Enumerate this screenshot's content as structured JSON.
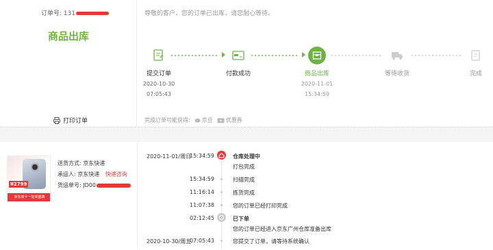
{
  "order": {
    "number_label": "订单号: 131",
    "status_title": "商品出库",
    "notice": "尊敬的客户，您的订单已出库，请您耐心等待。",
    "print_label": "打印订单"
  },
  "steps": [
    {
      "label": "提交订单",
      "date": "2020-10-30",
      "time": "07:05:43",
      "state": "done",
      "icon": "order-form-icon"
    },
    {
      "label": "付款成功",
      "date": "",
      "time": "",
      "state": "done",
      "icon": "payment-card-icon"
    },
    {
      "label": "商品出库",
      "date": "2020-11-01",
      "time": "15:34:59",
      "state": "current",
      "icon": "package-icon"
    },
    {
      "label": "等待收货",
      "date": "",
      "time": "",
      "state": "todo",
      "icon": "truck-icon"
    },
    {
      "label": "完成",
      "date": "",
      "time": "",
      "state": "todo",
      "icon": "complete-icon"
    }
  ],
  "available": {
    "label": "完成订单可能获得:",
    "bean": "京豆",
    "coupon": "优惠券"
  },
  "product": {
    "price": "¥2799",
    "banner": "京东双十一狂欢盛典"
  },
  "shipping": {
    "method_label": "送货方式:",
    "method_value": "京东快递",
    "carrier_label": "承运人:",
    "carrier_value": "京东快递",
    "consult_link": "快递咨询",
    "tracking_label": "货运单号:",
    "tracking_value": "JD00"
  },
  "timeline": [
    {
      "date": "2020-11-01/周日",
      "time": "15:34:59",
      "message": "仓库处理中",
      "kind": "head-red"
    },
    {
      "date": "",
      "time": "",
      "message": "打包完成",
      "kind": "plain"
    },
    {
      "date": "",
      "time": "15:34:59",
      "message": "扫描完成",
      "kind": "dot"
    },
    {
      "date": "",
      "time": "11:16:14",
      "message": "拣货完成",
      "kind": "dot"
    },
    {
      "date": "",
      "time": "11:07:38",
      "message": "您的订单已经打印完成",
      "kind": "dot"
    },
    {
      "date": "",
      "time": "02:12:45",
      "message": "已下单",
      "kind": "head-grey"
    },
    {
      "date": "",
      "time": "",
      "message": "您的订单已经进入京东广州仓库准备出库",
      "kind": "plain"
    },
    {
      "date": "2020-10-30/周五",
      "time": "07:05:43",
      "message": "您提交了订单，请等待系统确认",
      "kind": "dot"
    }
  ],
  "colors": {
    "green": "#71b247",
    "red": "#e4393c",
    "grey": "#ccc"
  }
}
